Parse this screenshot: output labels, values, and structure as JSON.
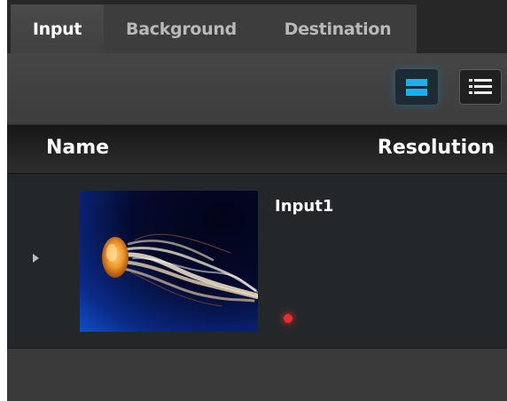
{
  "tabs": [
    {
      "label": "Input",
      "active": true
    },
    {
      "label": "Background",
      "active": false
    },
    {
      "label": "Destination",
      "active": false
    }
  ],
  "toolbar": {
    "grid_view_icon": "grid-view-icon",
    "list_view_icon": "list-view-icon",
    "active_view": "grid",
    "accent_color": "#17b3ee"
  },
  "columns": {
    "name": "Name",
    "resolution": "Resolution"
  },
  "inputs": [
    {
      "name": "Input1",
      "thumbnail": "jellyfish-image",
      "status": "red-status-dot",
      "status_color": "#e03030",
      "resolution": ""
    }
  ]
}
